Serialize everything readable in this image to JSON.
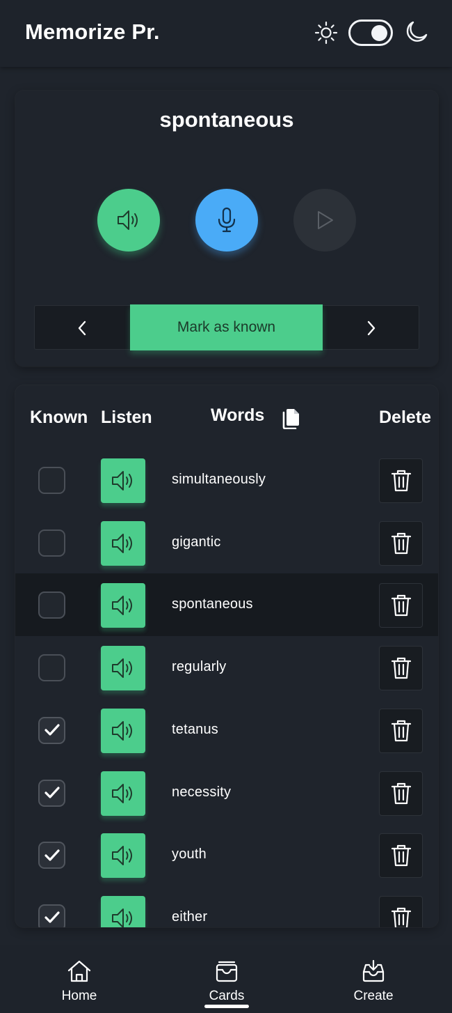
{
  "header": {
    "title": "Memorize Pr.",
    "theme": "dark"
  },
  "practice": {
    "current_word": "spontaneous",
    "listen_icon": "speaker-icon",
    "record_icon": "microphone-icon",
    "play_icon": "play-icon",
    "mark_known_label": "Mark as known"
  },
  "word_list": {
    "columns": {
      "known": "Known",
      "listen": "Listen",
      "words": "Words",
      "delete": "Delete"
    },
    "rows": [
      {
        "word": "simultaneously",
        "known": false,
        "active": false
      },
      {
        "word": "gigantic",
        "known": false,
        "active": false
      },
      {
        "word": "spontaneous",
        "known": false,
        "active": true
      },
      {
        "word": "regularly",
        "known": false,
        "active": false
      },
      {
        "word": "tetanus",
        "known": true,
        "active": false
      },
      {
        "word": "necessity",
        "known": true,
        "active": false
      },
      {
        "word": "youth",
        "known": true,
        "active": false
      },
      {
        "word": "either",
        "known": true,
        "active": false
      }
    ]
  },
  "bottom_nav": {
    "items": [
      {
        "label": "Home",
        "icon": "home-icon"
      },
      {
        "label": "Cards",
        "icon": "cards-icon",
        "active": true
      },
      {
        "label": "Create",
        "icon": "inbox-download-icon"
      }
    ]
  },
  "colors": {
    "accent_green": "#4ccd8c",
    "accent_blue": "#4aabf7",
    "background": "#1f242c"
  }
}
